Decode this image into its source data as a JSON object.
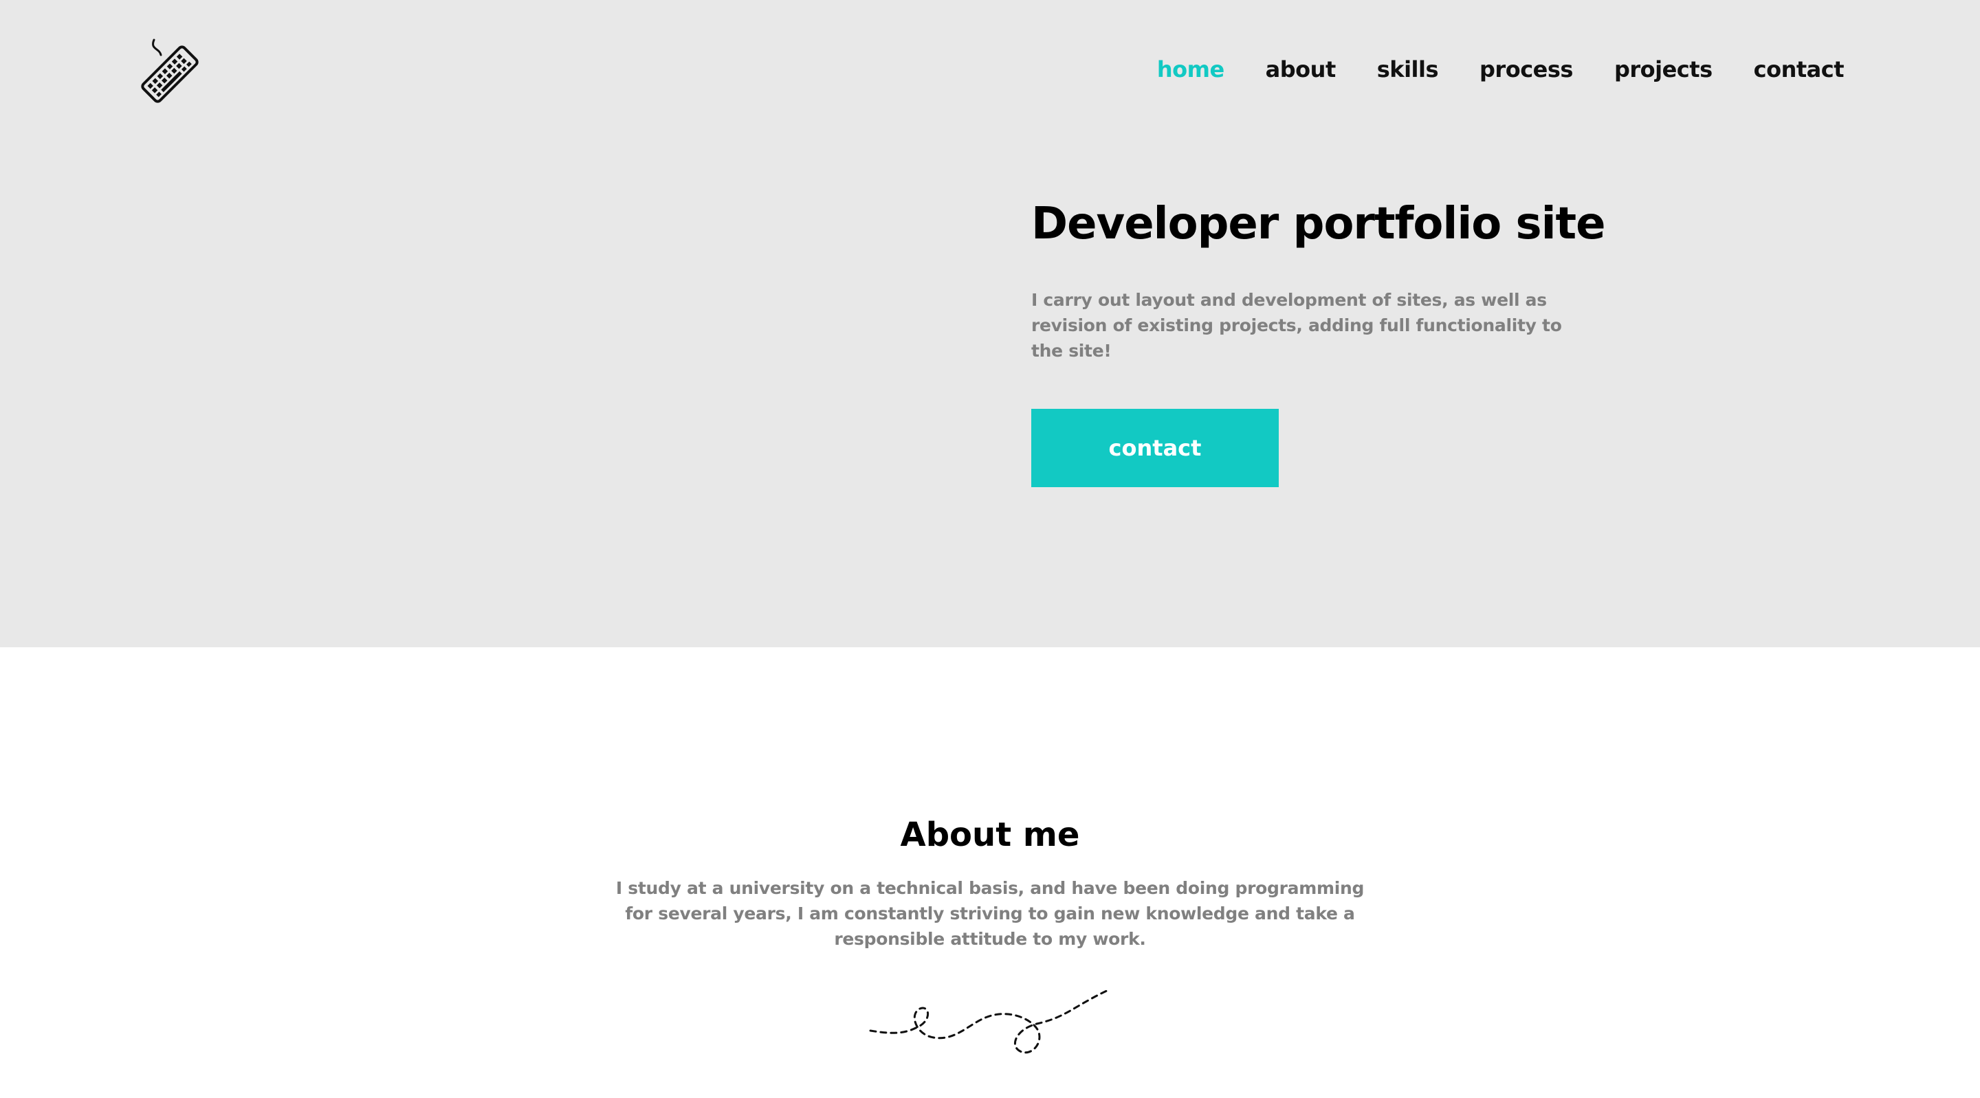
{
  "header": {
    "logo_icon": "keyboard-icon",
    "nav": [
      {
        "label": "home",
        "active": true
      },
      {
        "label": "about",
        "active": false
      },
      {
        "label": "skills",
        "active": false
      },
      {
        "label": "process",
        "active": false
      },
      {
        "label": "projects",
        "active": false
      },
      {
        "label": "contact",
        "active": false
      }
    ]
  },
  "hero": {
    "title": "Developer portfolio site",
    "text": "I carry out layout and development of sites, as well as revision of existing projects, adding full functionality to the site!",
    "button_label": "contact"
  },
  "about": {
    "title": "About me",
    "text": "I study at a university on a technical basis, and have been doing programming for several years, I am constantly striving to gain new knowledge and take a responsible attitude to my work.",
    "decoration_icon": "dashed-squiggle-icon"
  },
  "colors": {
    "accent": "#12c9c3",
    "hero_background": "#e8e8e8",
    "body_text": "#808080",
    "heading": "#000000"
  }
}
